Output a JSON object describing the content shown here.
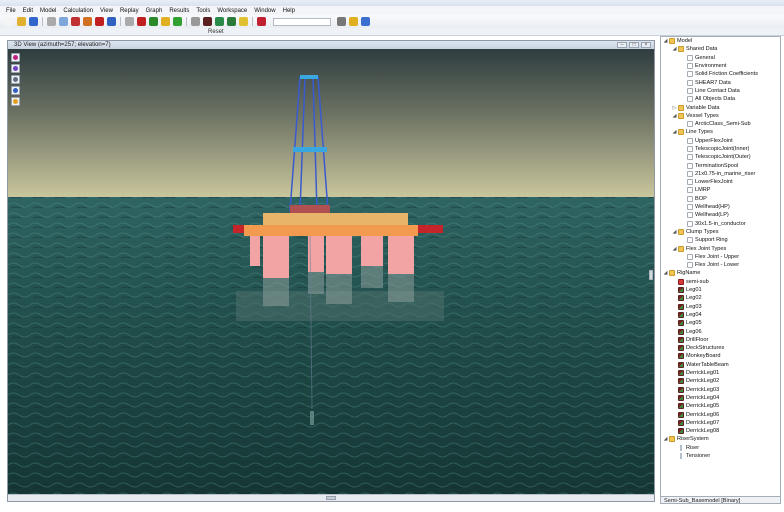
{
  "menu": [
    "File",
    "Edit",
    "Model",
    "Calculation",
    "View",
    "Replay",
    "Graph",
    "Results",
    "Tools",
    "Workspace",
    "Window",
    "Help"
  ],
  "toolbar": {
    "status_text": "Reset",
    "button_colors": [
      "#f4f4f4",
      "#e0b030",
      "#3366cc",
      "#aaaaaa",
      "#7fa6d8",
      "#c03030",
      "#d07020",
      "#c02020",
      "#3060c0",
      "#aaaaaa",
      "#c02020",
      "#2a8a2a",
      "#e0b020",
      "#30a030",
      "#999999",
      "#5a2020",
      "#2a8a4a",
      "#2a7a3a",
      "#e0c030",
      "#c02030",
      "#777777",
      "#e0b020",
      "#3a6fd0"
    ]
  },
  "viewport": {
    "title": "3D View (azimuth=257; elevation=7)",
    "controls": [
      "–",
      "□",
      "×"
    ],
    "tool_colors": [
      "#c02080",
      "#7040c0",
      "#607080",
      "#3060c0",
      "#e0a020"
    ]
  },
  "tree": {
    "items": [
      {
        "label": "Model",
        "level": 0,
        "icon": "folder",
        "expanded": true
      },
      {
        "label": "Shared Data",
        "level": 1,
        "icon": "folder",
        "expanded": true
      },
      {
        "label": "General",
        "level": 2,
        "icon": "page"
      },
      {
        "label": "Environment",
        "level": 2,
        "icon": "page"
      },
      {
        "label": "Solid Friction Coefficients",
        "level": 2,
        "icon": "page"
      },
      {
        "label": "SHEAR7 Data",
        "level": 2,
        "icon": "page"
      },
      {
        "label": "Line Contact Data",
        "level": 2,
        "icon": "page"
      },
      {
        "label": "All Objects Data",
        "level": 2,
        "icon": "page"
      },
      {
        "label": "Variable Data",
        "level": 1,
        "icon": "folder",
        "expanded": false
      },
      {
        "label": "Vessel Types",
        "level": 1,
        "icon": "folder",
        "expanded": true
      },
      {
        "label": "ArcticClass_Semi-Sub",
        "level": 2,
        "icon": "vessel"
      },
      {
        "label": "Line Types",
        "level": 1,
        "icon": "folder",
        "expanded": true
      },
      {
        "label": "UpperFlexJoint",
        "level": 2,
        "icon": "page"
      },
      {
        "label": "TelescopicJoint(Inner)",
        "level": 2,
        "icon": "page"
      },
      {
        "label": "TelescopicJoint(Outer)",
        "level": 2,
        "icon": "page"
      },
      {
        "label": "TerminationSpool",
        "level": 2,
        "icon": "page"
      },
      {
        "label": "21x0.75-in_marine_riser",
        "level": 2,
        "icon": "page"
      },
      {
        "label": "LowerFlexJoint",
        "level": 2,
        "icon": "page"
      },
      {
        "label": "LMRP",
        "level": 2,
        "icon": "page"
      },
      {
        "label": "BOP",
        "level": 2,
        "icon": "page"
      },
      {
        "label": "Wellhead(HP)",
        "level": 2,
        "icon": "page"
      },
      {
        "label": "Wellhead(LP)",
        "level": 2,
        "icon": "page"
      },
      {
        "label": "30x1.5-in_conductor",
        "level": 2,
        "icon": "page"
      },
      {
        "label": "Clump Types",
        "level": 1,
        "icon": "folder",
        "expanded": true
      },
      {
        "label": "Support Ring",
        "level": 2,
        "icon": "page"
      },
      {
        "label": "Flex Joint Types",
        "level": 1,
        "icon": "folder",
        "expanded": true
      },
      {
        "label": "Flex Joint - Upper",
        "level": 2,
        "icon": "page"
      },
      {
        "label": "Flex Joint - Lower",
        "level": 2,
        "icon": "page"
      },
      {
        "label": "RigName",
        "level": 0,
        "icon": "folder",
        "expanded": true
      },
      {
        "label": "semi-sub",
        "level": 1,
        "icon": "rig"
      },
      {
        "label": "Leg01",
        "level": 1,
        "icon": "leg"
      },
      {
        "label": "Leg02",
        "level": 1,
        "icon": "leg"
      },
      {
        "label": "Leg03",
        "level": 1,
        "icon": "leg"
      },
      {
        "label": "Leg04",
        "level": 1,
        "icon": "leg"
      },
      {
        "label": "Leg05",
        "level": 1,
        "icon": "leg"
      },
      {
        "label": "Leg06",
        "level": 1,
        "icon": "leg"
      },
      {
        "label": "DrillFloor",
        "level": 1,
        "icon": "leg"
      },
      {
        "label": "DeckStructures",
        "level": 1,
        "icon": "leg"
      },
      {
        "label": "MonkeyBoard",
        "level": 1,
        "icon": "leg"
      },
      {
        "label": "WaterTableBeam",
        "level": 1,
        "icon": "leg"
      },
      {
        "label": "DerrickLeg01",
        "level": 1,
        "icon": "leg"
      },
      {
        "label": "DerrickLeg02",
        "level": 1,
        "icon": "leg"
      },
      {
        "label": "DerrickLeg03",
        "level": 1,
        "icon": "leg"
      },
      {
        "label": "DerrickLeg04",
        "level": 1,
        "icon": "leg"
      },
      {
        "label": "DerrickLeg05",
        "level": 1,
        "icon": "leg"
      },
      {
        "label": "DerrickLeg06",
        "level": 1,
        "icon": "leg"
      },
      {
        "label": "DerrickLeg07",
        "level": 1,
        "icon": "leg"
      },
      {
        "label": "DerrickLeg08",
        "level": 1,
        "icon": "leg"
      },
      {
        "label": "RiserSystem",
        "level": 0,
        "icon": "folder",
        "expanded": true
      },
      {
        "label": "Riser",
        "level": 1,
        "icon": "line"
      },
      {
        "label": "Tensioner",
        "level": 1,
        "icon": "line"
      }
    ],
    "footer": "Semi-Sub_Basemodel [Binary]"
  },
  "colors": {
    "sky_top": "#3b4a4c",
    "sky_horizon": "#c9c69c",
    "sea": "#1f4a47",
    "deck": "#f29a4e",
    "deck_top": "#e8b46a",
    "deck_wing": "#c4242a",
    "column": "#f2a4a4",
    "derrick": "#3a5ad0",
    "derrick_band": "#39a8e0",
    "drill_floor": "#b05050"
  }
}
